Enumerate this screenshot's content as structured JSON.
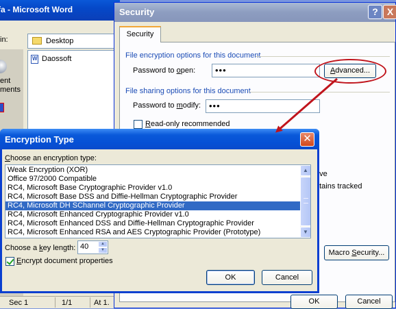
{
  "word_window": {
    "title": "fa - Microsoft Word",
    "save_in_label": "in:",
    "location": "Desktop",
    "places_label": "ent\nments",
    "file_name": "Daossoft",
    "status": {
      "sec": "Sec 1",
      "page": "1/1",
      "at": "At 1."
    }
  },
  "security_dialog": {
    "title": "Security",
    "help_glyph": "?",
    "close_glyph": "X",
    "tab_label": "Security",
    "encrypt_heading": "File encryption options for this document",
    "password_open_label_pre": "Password to ",
    "password_open_label_key": "o",
    "password_open_label_post": "pen:",
    "password_open_value": "•••",
    "advanced_label_pre": "",
    "advanced_label_key": "A",
    "advanced_label_post": "dvanced...",
    "share_heading": "File sharing options for this document",
    "password_modify_label_pre": "Password to ",
    "password_modify_label_key": "m",
    "password_modify_label_post": "odify:",
    "password_modify_value": "•••",
    "readonly_label_pre": "",
    "readonly_label_key": "R",
    "readonly_label_post": "ead-only recommended",
    "partial_save": "ave",
    "partial_tracked": "ntains tracked",
    "macro_label_pre": "Macro ",
    "macro_label_key": "S",
    "macro_label_post": "ecurity...",
    "ok_label": "OK",
    "cancel_label": "Cancel"
  },
  "encryption_dialog": {
    "title": "Encryption Type",
    "close_glyph": "✕",
    "choose_label_pre": "",
    "choose_label_key": "C",
    "choose_label_post": "hoose an encryption type:",
    "types": [
      "Weak Encryption (XOR)",
      "Office 97/2000 Compatible",
      "RC4, Microsoft Base Cryptographic Provider v1.0",
      "RC4, Microsoft Base DSS and Diffie-Hellman Cryptographic Provider",
      "RC4, Microsoft DH SChannel Cryptographic Provider",
      "RC4, Microsoft Enhanced Cryptographic Provider v1.0",
      "RC4, Microsoft Enhanced DSS and Diffie-Hellman Cryptographic Provider",
      "RC4, Microsoft Enhanced RSA and AES Cryptographic Provider (Prototype)"
    ],
    "selected_index": 4,
    "key_length_label_pre": "Choose a ",
    "key_length_label_key": "k",
    "key_length_label_post": "ey length:",
    "key_length_value": "40",
    "encrypt_props_label_pre": "",
    "encrypt_props_label_key": "E",
    "encrypt_props_label_post": "ncrypt document properties",
    "encrypt_props_checked": true,
    "ok_label": "OK",
    "cancel_label": "Cancel"
  },
  "colors": {
    "annotation": "#c0141c",
    "selection": "#316ac5",
    "xp_blue": "#0a59d9"
  }
}
